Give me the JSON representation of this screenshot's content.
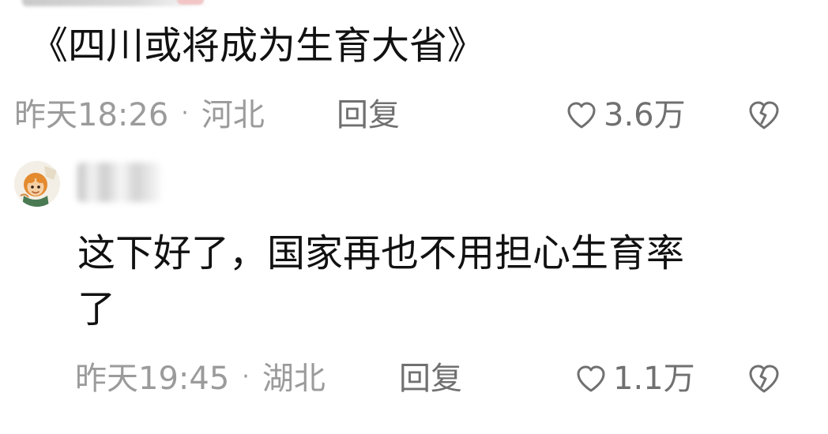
{
  "comments": [
    {
      "text": "《四川或将成为生育大省》",
      "time": "昨天18:26",
      "separator": "·",
      "location": "河北",
      "reply_label": "回复",
      "likes": "3.6万"
    },
    {
      "username": "",
      "text_line1": "这下好了，国家再也不用担心生育率",
      "text_line2": "了",
      "time": "昨天19:45",
      "separator": "·",
      "location": "湖北",
      "reply_label": "回复",
      "likes": "1.1万"
    }
  ],
  "icons": {
    "like": "heart-outline-icon",
    "dislike": "broken-heart-icon"
  },
  "colors": {
    "text": "#111111",
    "meta": "#9b9b9b",
    "action": "#707070",
    "background": "#ffffff"
  }
}
